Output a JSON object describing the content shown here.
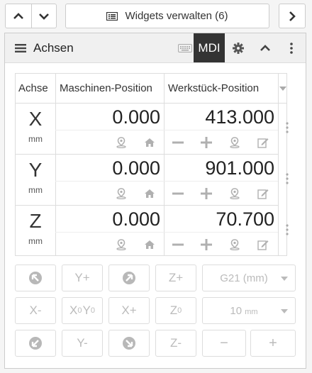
{
  "toolbar": {
    "manage_label": "Widgets verwalten (6)"
  },
  "panel": {
    "title": "Achsen",
    "mdi_label": "MDI"
  },
  "axes_table": {
    "headers": [
      "Achse",
      "Maschinen-Position",
      "Werkstück-Position"
    ],
    "rows": [
      {
        "axis": "X",
        "unit": "mm",
        "machine_pos": "0.000",
        "work_pos": "413.000"
      },
      {
        "axis": "Y",
        "unit": "mm",
        "machine_pos": "0.000",
        "work_pos": "901.000"
      },
      {
        "axis": "Z",
        "unit": "mm",
        "machine_pos": "0.000",
        "work_pos": "70.700"
      }
    ]
  },
  "jog": {
    "y_plus": "Y+",
    "z_plus": "Z+",
    "x_minus": "X-",
    "x_plus": "X+",
    "x0y0": {
      "x": "X",
      "x_sub": "0",
      "y": "Y",
      "y_sub": "0"
    },
    "z0": {
      "z": "Z",
      "z_sub": "0"
    },
    "y_minus": "Y-",
    "z_minus": "Z-",
    "units_select": "G21 (mm)",
    "step_select": {
      "value": "10",
      "unit": "mm"
    },
    "minus": "−",
    "plus": "+"
  },
  "colors": {
    "mdi_active_bg": "#333333",
    "disabled_text": "#bbbbbb",
    "icon_gray": "#b0b0b0"
  }
}
